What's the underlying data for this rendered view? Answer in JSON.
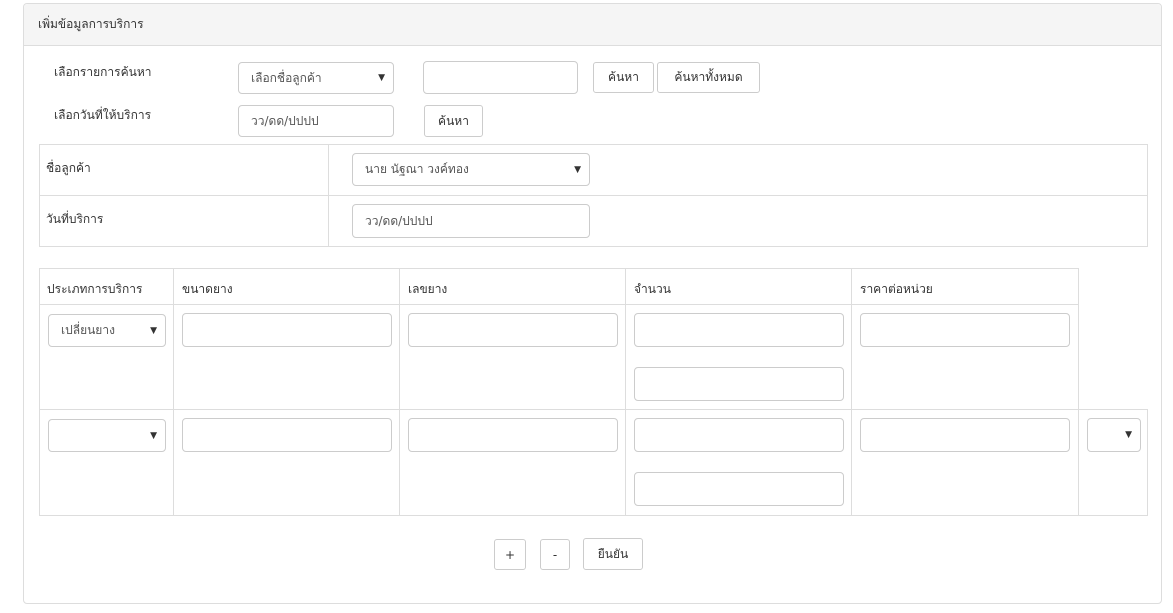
{
  "panel": {
    "title": "เพิ่มข้อมูลการบริการ"
  },
  "search": {
    "label_list": "เลือกรายการค้นหา",
    "customer_select": "เลือกชื่อลูกค้า",
    "text_value": "",
    "search_btn": "ค้นหา",
    "search_all_btn": "ค้นหาทั้งหมด",
    "label_date": "เลือกวันที่ให้บริการ",
    "date_placeholder": "วว/ดด/ปปปป",
    "date_search_btn": "ค้นหา"
  },
  "info": {
    "customer_label": "ชื่อลูกค้า",
    "customer_value": "นาย นัฐณา วงค์ทอง",
    "date_label": "วันที่บริการ",
    "date_placeholder": "วว/ดด/ปปปป"
  },
  "table": {
    "headers": [
      "ประเภทการบริการ",
      "ขนาดยาง",
      "เลขยาง",
      "จำนวน",
      "ราคาต่อหน่วย"
    ],
    "rows": [
      {
        "service_type": "เปลี่ยนยาง"
      },
      {
        "service_type": ""
      }
    ]
  },
  "actions": {
    "add": "+",
    "remove": "-",
    "confirm": "ยืนยัน"
  },
  "icons": {
    "caret": "caret-down-icon"
  }
}
